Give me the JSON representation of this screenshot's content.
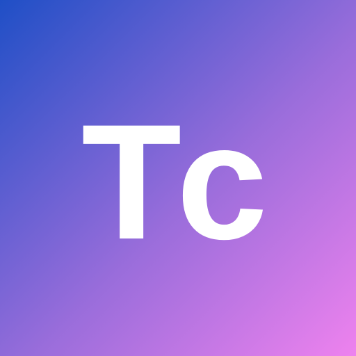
{
  "avatar": {
    "initials": "Tc",
    "text_color": "#ffffff",
    "gradient_start": "#1f4fc6",
    "gradient_mid": "#9a6ddb",
    "gradient_end": "#ee82ee"
  }
}
